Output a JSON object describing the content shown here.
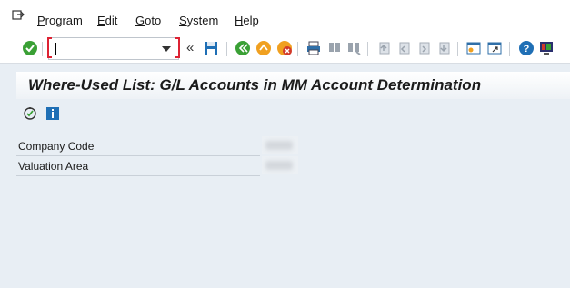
{
  "menu": {
    "items": [
      {
        "label": "Program",
        "u": "P"
      },
      {
        "label": "Edit",
        "u": "E"
      },
      {
        "label": "Goto",
        "u": "G"
      },
      {
        "label": "System",
        "u": "S"
      },
      {
        "label": "Help",
        "u": "H"
      }
    ]
  },
  "toolbar": {
    "command_value": "",
    "collapse_glyph": "«"
  },
  "title": "Where-Used List: G/L Accounts in MM Account Determination",
  "fields": [
    {
      "label": "Company Code"
    },
    {
      "label": "Valuation Area"
    }
  ],
  "colors": {
    "accent_green": "#3aa035",
    "accent_orange": "#f0a020",
    "accent_red": "#d23a2a",
    "brand_blue": "#1f6fb5"
  }
}
